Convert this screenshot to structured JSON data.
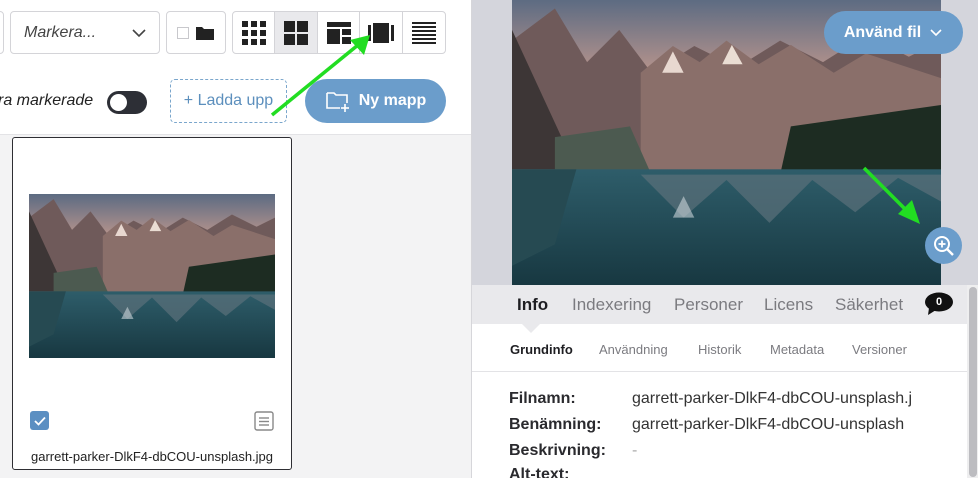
{
  "toolbar": {
    "select_value": "Markera...",
    "view_modes": [
      "grid-small",
      "grid-large",
      "grid-masonry",
      "grid-film",
      "list"
    ],
    "active_view": "grid-large",
    "toggle_label": "ra markerade",
    "upload_label": "+ Ladda upp",
    "new_folder_label": "Ny mapp"
  },
  "file_card": {
    "filename": "garrett-parker-DlkF4-dbCOU-unsplash.jpg",
    "checked": true
  },
  "preview": {
    "use_file_label": "Använd fil"
  },
  "tabs": [
    {
      "label": "Info",
      "active": true
    },
    {
      "label": "Indexering",
      "active": false
    },
    {
      "label": "Personer",
      "active": false
    },
    {
      "label": "Licens",
      "active": false
    },
    {
      "label": "Säkerhet",
      "active": false
    }
  ],
  "comment_count": "0",
  "subtabs": [
    {
      "label": "Grundinfo",
      "active": true
    },
    {
      "label": "Användning",
      "active": false
    },
    {
      "label": "Historik",
      "active": false
    },
    {
      "label": "Metadata",
      "active": false
    },
    {
      "label": "Versioner",
      "active": false
    }
  ],
  "info": {
    "rows": [
      {
        "key": "Filnamn:",
        "value": "garrett-parker-DlkF4-dbCOU-unsplash.j"
      },
      {
        "key": "Benämning:",
        "value": "garrett-parker-DlkF4-dbCOU-unsplash"
      },
      {
        "key": "Beskrivning:",
        "value": "-"
      },
      {
        "key": "Alt-text:",
        "value": ""
      }
    ]
  },
  "colors": {
    "accent": "#6b9dcb",
    "annotation_arrow": "#22dd22"
  }
}
